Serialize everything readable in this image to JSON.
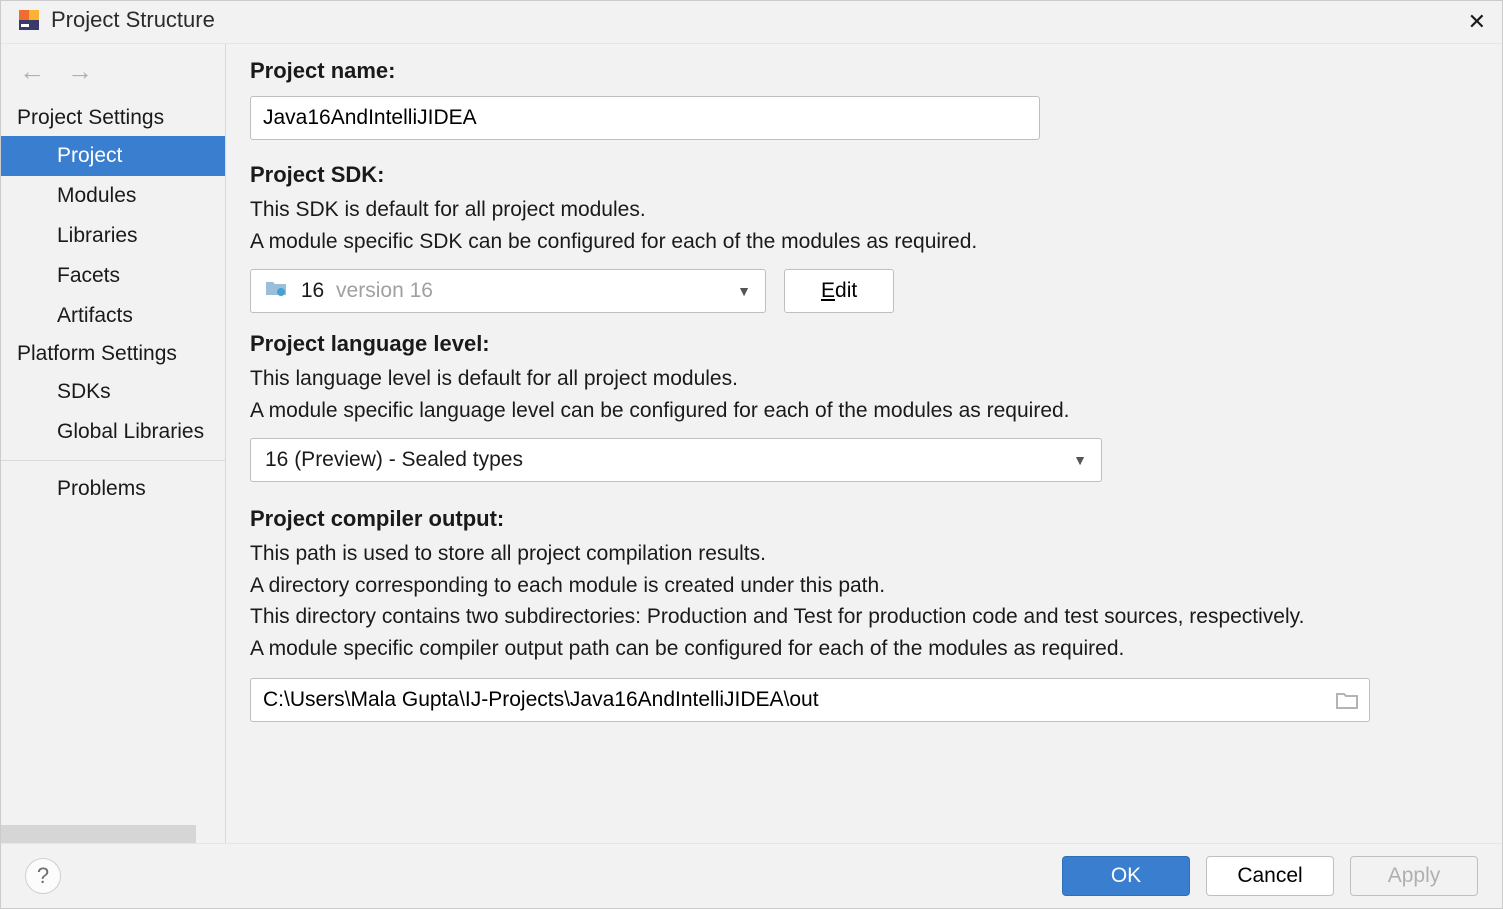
{
  "window": {
    "title": "Project Structure"
  },
  "sidebar": {
    "groups": [
      {
        "header": "Project Settings",
        "items": [
          "Project",
          "Modules",
          "Libraries",
          "Facets",
          "Artifacts"
        ]
      },
      {
        "header": "Platform Settings",
        "items": [
          "SDKs",
          "Global Libraries"
        ]
      }
    ],
    "extra": [
      "Problems"
    ],
    "selected": "Project"
  },
  "main": {
    "projectName": {
      "label": "Project name:",
      "value": "Java16AndIntelliJIDEA"
    },
    "projectSdk": {
      "label": "Project SDK:",
      "desc1": "This SDK is default for all project modules.",
      "desc2": "A module specific SDK can be configured for each of the modules as required.",
      "valueStrong": "16",
      "valueDim": "version 16",
      "editLabel": "Edit"
    },
    "langLevel": {
      "label": "Project language level:",
      "desc1": "This language level is default for all project modules.",
      "desc2": "A module specific language level can be configured for each of the modules as required.",
      "value": "16 (Preview) - Sealed types"
    },
    "compilerOut": {
      "label": "Project compiler output:",
      "desc1": "This path is used to store all project compilation results.",
      "desc2": "A directory corresponding to each module is created under this path.",
      "desc3": "This directory contains two subdirectories: Production and Test for production code and test sources, respectively.",
      "desc4": "A module specific compiler output path can be configured for each of the modules as required.",
      "value": "C:\\Users\\Mala Gupta\\IJ-Projects\\Java16AndIntelliJIDEA\\out"
    }
  },
  "footer": {
    "ok": "OK",
    "cancel": "Cancel",
    "apply": "Apply"
  }
}
